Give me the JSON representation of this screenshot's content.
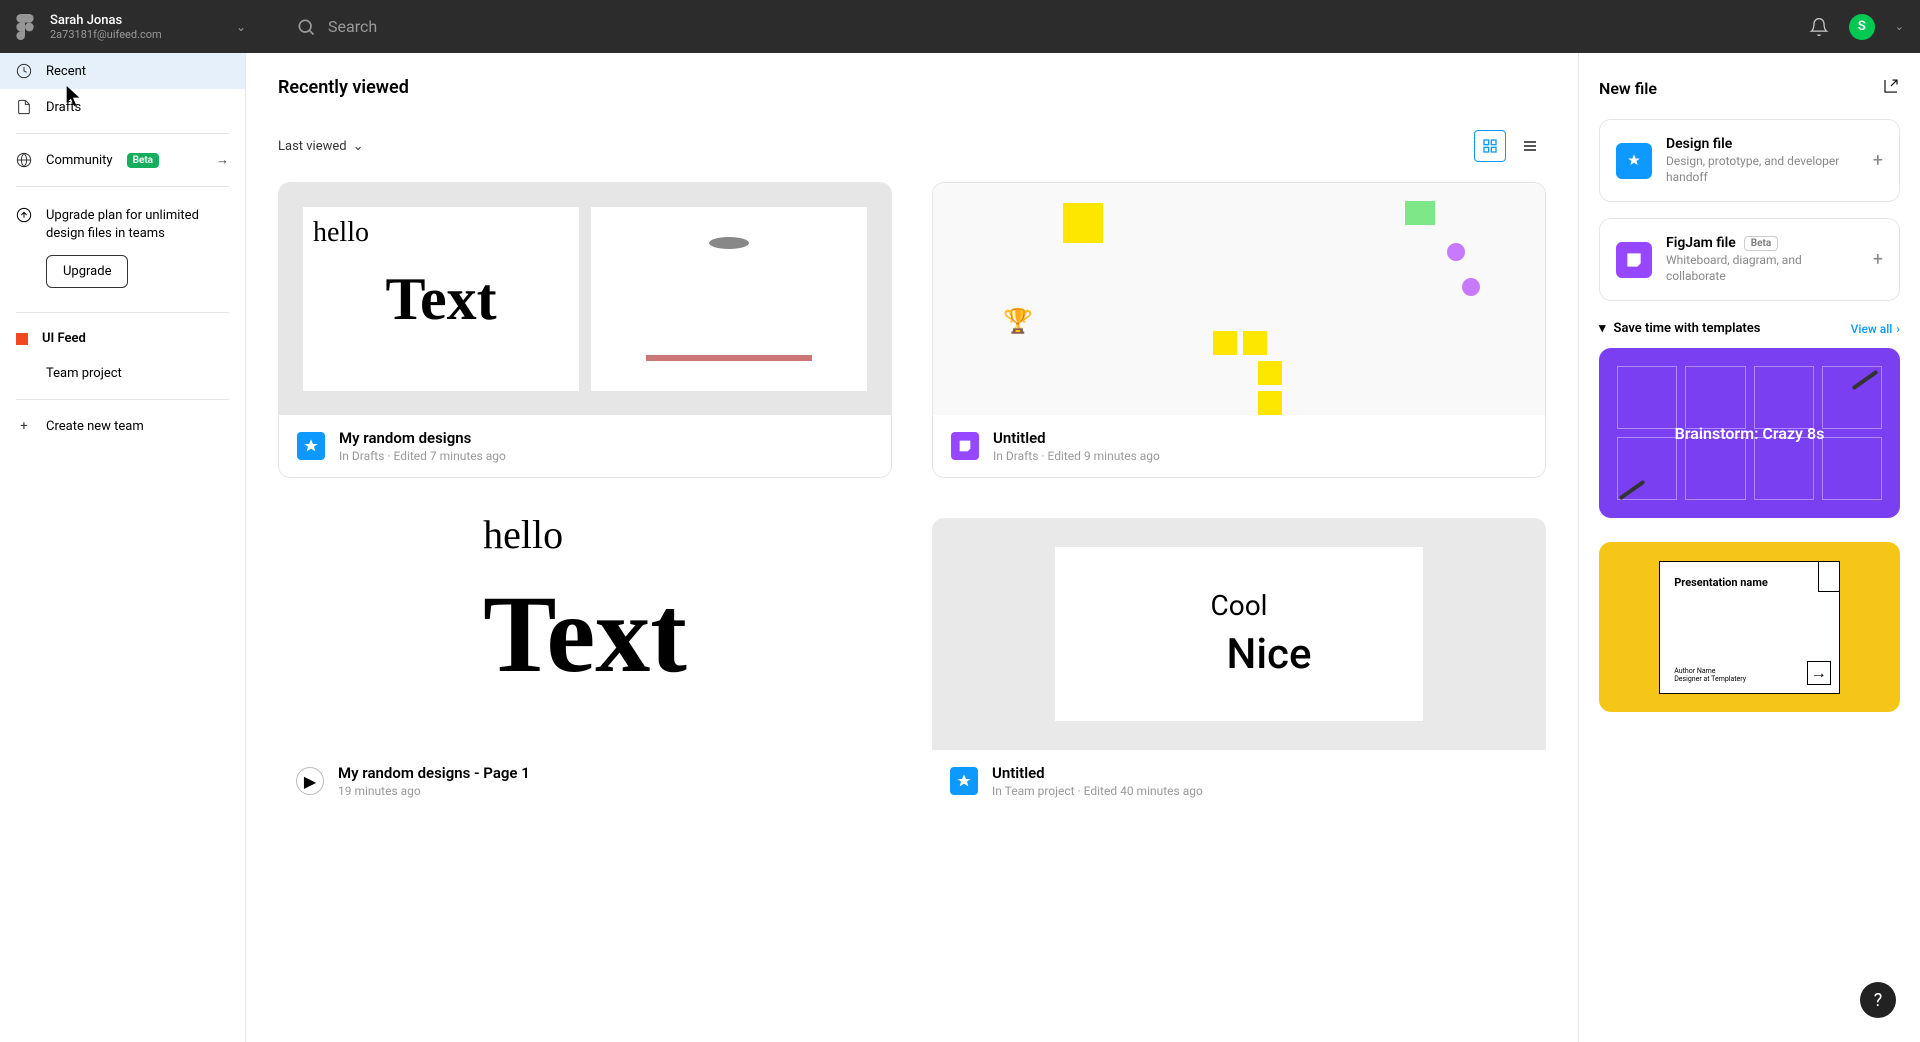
{
  "user": {
    "name": "Sarah Jonas",
    "email": "2a73181f@uifeed.com",
    "avatar_initial": "S"
  },
  "search": {
    "placeholder": "Search"
  },
  "sidebar": {
    "recent": "Recent",
    "drafts": "Drafts",
    "community": "Community",
    "community_badge": "Beta",
    "upgrade_text": "Upgrade plan for unlimited design files in teams",
    "upgrade_button": "Upgrade",
    "team_name": "UI Feed",
    "team_project": "Team project",
    "create_team": "Create new team"
  },
  "center": {
    "title": "Recently viewed",
    "sort": "Last viewed",
    "cards": [
      {
        "title": "My random designs",
        "sub": "In Drafts · Edited 7 minutes ago",
        "thumb_text": "Text",
        "thumb_hello": "hello",
        "type": "design"
      },
      {
        "title": "Untitled",
        "sub": "In Drafts · Edited 9 minutes ago",
        "type": "figjam"
      },
      {
        "title": "My random designs - Page 1",
        "sub": "19 minutes ago",
        "thumb_text": "Text",
        "thumb_hello": "hello",
        "type": "proto"
      },
      {
        "title": "Untitled",
        "sub": "In Team project · Edited 40 minutes ago",
        "word1": "Cool",
        "word2": "Nice",
        "type": "design"
      }
    ]
  },
  "right": {
    "title": "New file",
    "design_title": "Design file",
    "design_sub": "Design, prototype, and developer handoff",
    "figjam_title": "FigJam file",
    "figjam_badge": "Beta",
    "figjam_sub": "Whiteboard, diagram, and collaborate",
    "templates_title": "Save time with templates",
    "viewall": "View all",
    "template1": "Brainstorm: Crazy 8s",
    "template2_title": "Presentation name",
    "template2_author": "Author Name\nDesigner at Templatery"
  }
}
